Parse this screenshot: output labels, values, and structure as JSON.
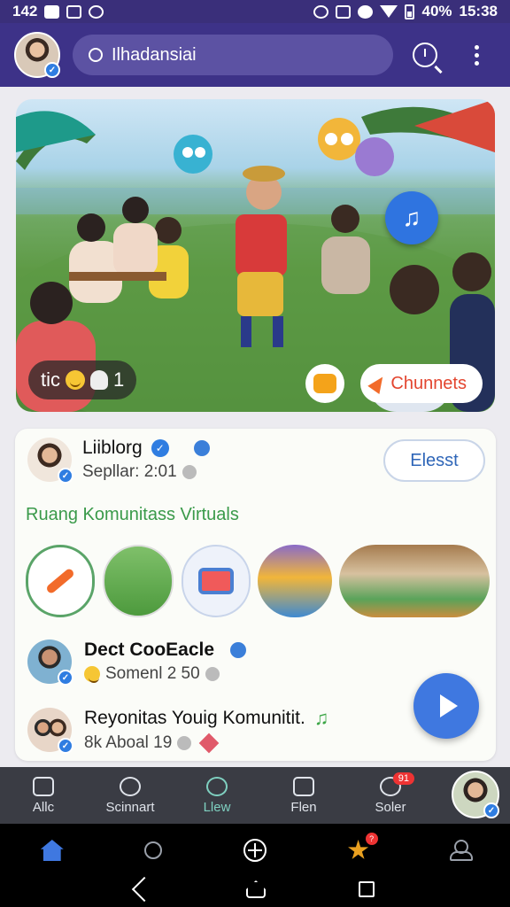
{
  "status_bar": {
    "time": "142",
    "battery": "40%",
    "clock": "15:38"
  },
  "header": {
    "search_text": "Ilhadansiai",
    "icons": [
      "avatar",
      "search-icon",
      "clock-search-icon",
      "kebab-menu-icon"
    ]
  },
  "hero": {
    "chip_text": "tic",
    "chip_count": "1",
    "channels_label": "Chunnets"
  },
  "post": {
    "author": "Liiblorg",
    "meta": "Sepllar: 2:01",
    "follow_label": "Elesst",
    "section_title": "Ruang Komunitass Virtuals"
  },
  "feed": [
    {
      "title": "Dect CooEacle",
      "meta": "Somenl 2 50"
    },
    {
      "title": "Reyonitas Youig Komunitit.",
      "meta": "8k Aboal 19"
    }
  ],
  "bottom_nav": [
    {
      "label": "Allc",
      "icon": "home-icon"
    },
    {
      "label": "Scinnart",
      "icon": "camera-icon"
    },
    {
      "label": "Llew",
      "icon": "search-icon"
    },
    {
      "label": "Flen",
      "icon": "edit-icon"
    },
    {
      "label": "Soler",
      "icon": "chat-icon",
      "badge": "91"
    }
  ],
  "system_nav": {
    "notification_badge": "?"
  },
  "colors": {
    "header": "#3d3288",
    "accent_blue": "#3f78e0",
    "green_title": "#3a9a4a",
    "channels_red": "#e3452f"
  }
}
